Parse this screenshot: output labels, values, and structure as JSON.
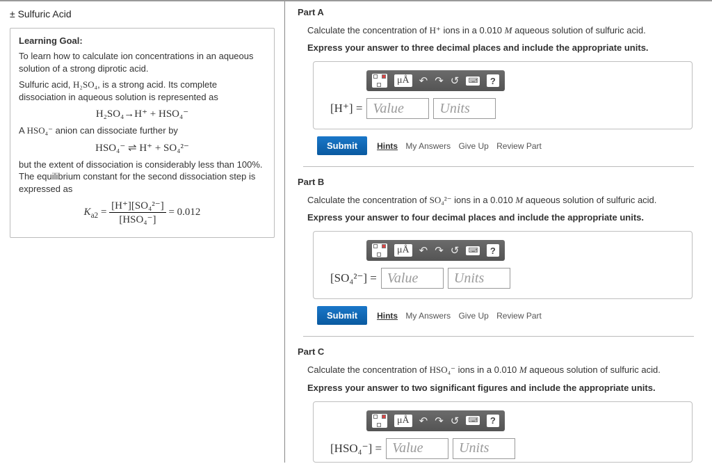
{
  "sidebar": {
    "title": "± Sulfuric Acid",
    "lg_heading": "Learning Goal:",
    "lg_p1": "To learn how to calculate ion concentrations in an aqueous solution of a strong diprotic acid.",
    "lg_p2a": "Sulfuric acid, ",
    "lg_p2b": ", is a strong acid. Its complete dissociation in aqueous solution is represented as",
    "lg_p3a": "A ",
    "lg_p3b": " anion can dissociate further by",
    "lg_p4": "but the extent of dissociation is considerably less than 100%. The equilibrium constant for the second dissociation step is expressed as",
    "ka2_value": "= 0.012",
    "formula_h2so4": "H₂SO₄",
    "formula_hso4": "HSO₄⁻",
    "eq1": "H₂SO₄→H⁺ + HSO₄⁻",
    "eq2": "HSO₄⁻ ⇌ H⁺ + SO₄²⁻",
    "ka2_label": "K",
    "ka2_sub": "a2",
    "frac_num": "[H⁺][SO₄²⁻]",
    "frac_den": "[HSO₄⁻]"
  },
  "toolbar": {
    "mu": "μÅ",
    "undo": "↶",
    "redo": "↷",
    "reset": "↺",
    "help": "?"
  },
  "inputs": {
    "value_ph": "Value",
    "units_ph": "Units"
  },
  "actions": {
    "submit": "Submit",
    "hints": "Hints",
    "my_answers": "My Answers",
    "give_up": "Give Up",
    "review": "Review Part"
  },
  "parts": {
    "a": {
      "title": "Part A",
      "prompt_pre": "Calculate the concentration of ",
      "prompt_ion": "H⁺",
      "prompt_post": " ions in a 0.010 ",
      "prompt_M": "M",
      "prompt_end": " aqueous solution of sulfuric acid.",
      "instruct": "Express your answer to three decimal places and include the appropriate units.",
      "lhs": "[H⁺] ="
    },
    "b": {
      "title": "Part B",
      "prompt_pre": "Calculate the concentration of ",
      "prompt_ion": "SO₄²⁻",
      "prompt_post": " ions in a 0.010 ",
      "prompt_M": "M",
      "prompt_end": " aqueous solution of sulfuric acid.",
      "instruct": "Express your answer to four decimal places and include the appropriate units.",
      "lhs": "[SO₄²⁻] ="
    },
    "c": {
      "title": "Part C",
      "prompt_pre": "Calculate the concentration of ",
      "prompt_ion": "HSO₄⁻",
      "prompt_post": " ions in a 0.010 ",
      "prompt_M": "M",
      "prompt_end": " aqueous solution of sulfuric acid.",
      "instruct": "Express your answer to two significant figures and include the appropriate units.",
      "lhs": "[HSO₄⁻] ="
    }
  }
}
